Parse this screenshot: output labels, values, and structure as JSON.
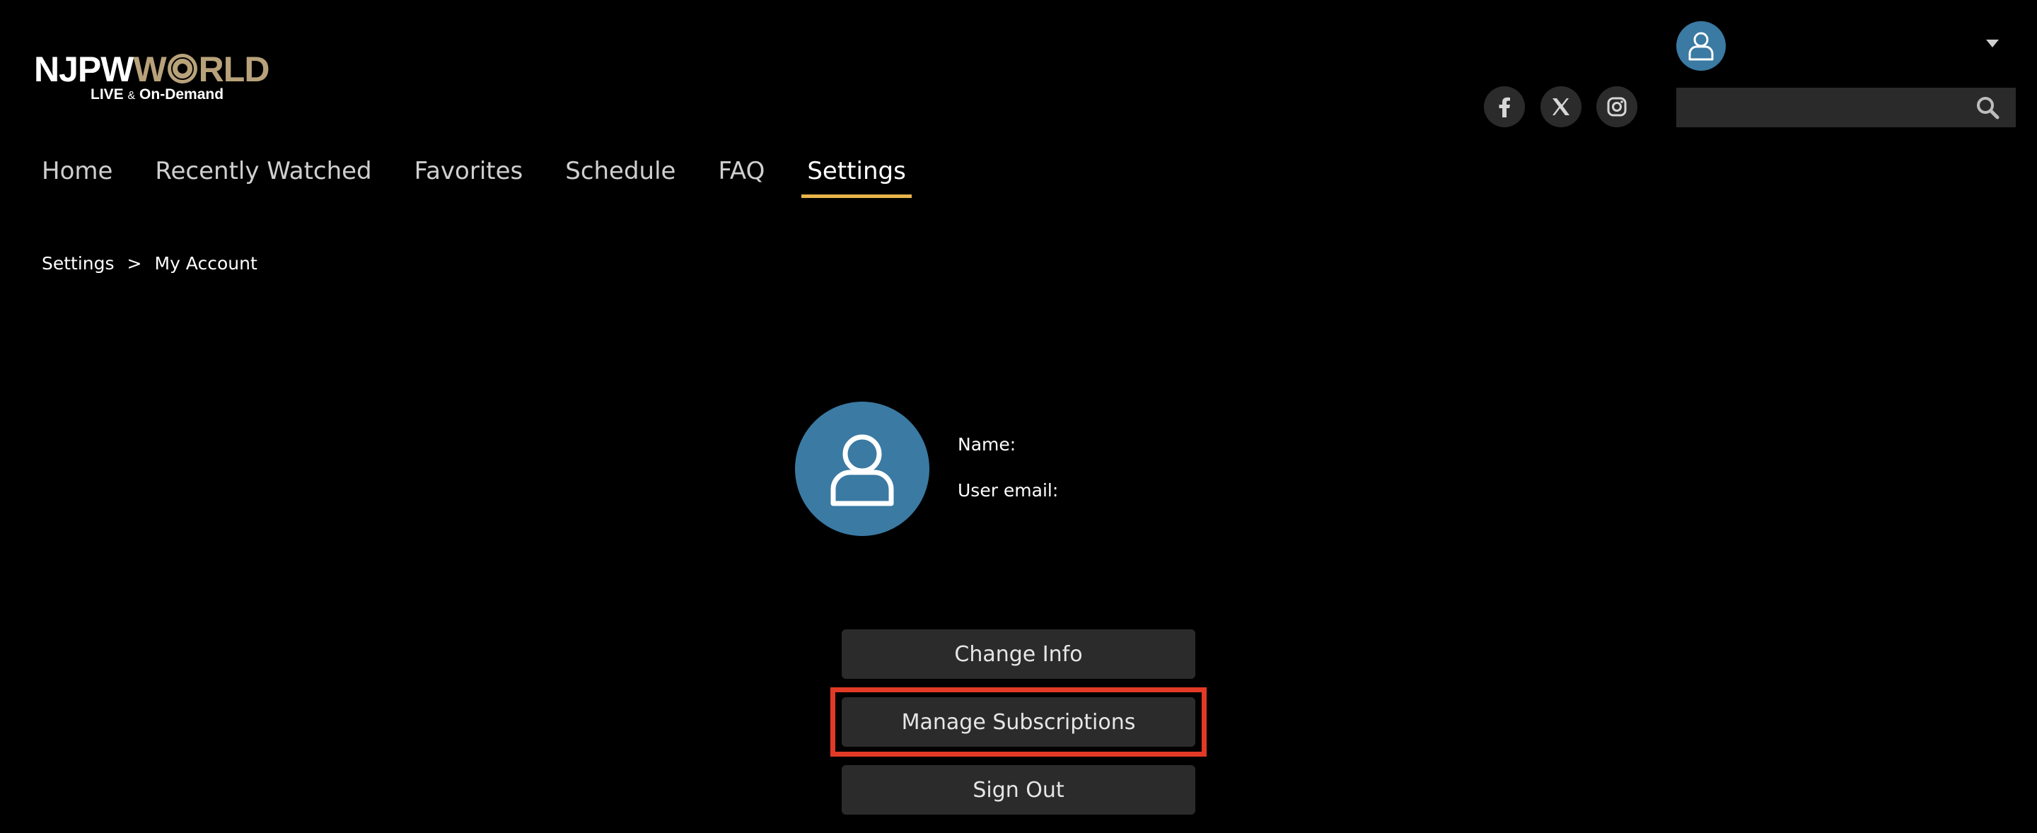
{
  "logo": {
    "part1": "NJPW",
    "seal_letter": "O",
    "part2": "RLD",
    "part2_prefix": "W",
    "sub_main": "LIVE",
    "sub_amp": "&",
    "sub_rest": "On-Demand"
  },
  "header": {
    "user_icon": "user-icon",
    "dropdown_icon": "chevron-down-icon",
    "social": [
      {
        "name": "facebook-icon"
      },
      {
        "name": "x-twitter-icon"
      },
      {
        "name": "instagram-icon"
      }
    ],
    "search": {
      "value": "",
      "placeholder": ""
    }
  },
  "nav": {
    "items": [
      {
        "label": "Home"
      },
      {
        "label": "Recently Watched"
      },
      {
        "label": "Favorites"
      },
      {
        "label": "Schedule"
      },
      {
        "label": "FAQ"
      },
      {
        "label": "Settings",
        "active": true
      }
    ]
  },
  "breadcrumb": {
    "root": "Settings",
    "separator": ">",
    "current": "My Account"
  },
  "profile": {
    "name_label": "Name:",
    "email_label": "User email:"
  },
  "actions": {
    "change_info": "Change Info",
    "manage_subscriptions": "Manage Subscriptions",
    "sign_out": "Sign Out"
  },
  "colors": {
    "background": "#000000",
    "avatar": "#3a7aa3",
    "nav_active_underline": "#e8b54a",
    "button_bg": "#2b2b2b",
    "highlight": "#e23a26",
    "logo_gold": "#b8a27a"
  }
}
